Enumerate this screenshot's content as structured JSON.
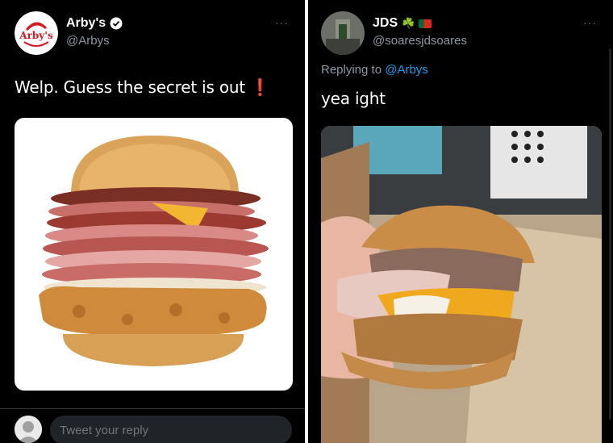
{
  "left_tweet": {
    "author": {
      "display_name": "Arby's",
      "handle": "@Arbys",
      "logo_text": "Arby's",
      "verified": true
    },
    "more_label": "···",
    "text": "Welp. Guess the secret is out",
    "emoji": "❗",
    "image_description_icon": "burger-photo",
    "reply_placeholder": "Tweet your reply"
  },
  "right_tweet": {
    "author": {
      "display_name": "JDS",
      "handle": "@soaresjdsoares",
      "badges": [
        "☘️",
        "🇵🇹"
      ]
    },
    "more_label": "···",
    "replying_to_prefix": "Replying to",
    "replying_to_handle": "@Arbys",
    "text": "yea ight"
  },
  "colors": {
    "background": "#000000",
    "text": "#e7e9ea",
    "secondary": "#8b98a5",
    "accent": "#1d9bf0",
    "arbys_red": "#d71920"
  }
}
